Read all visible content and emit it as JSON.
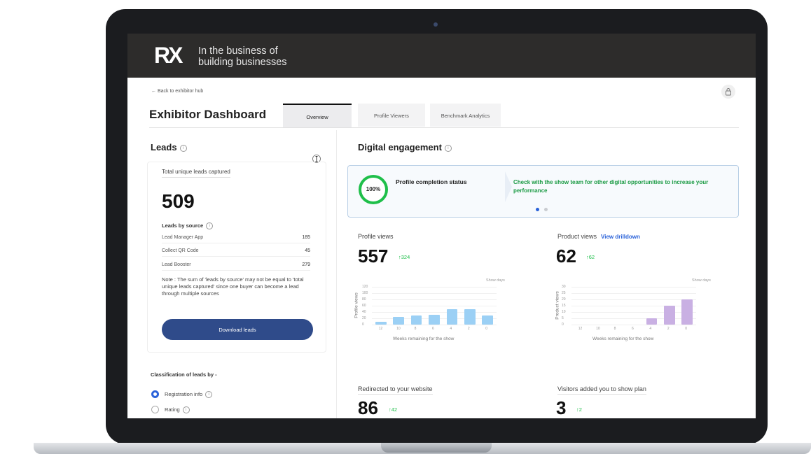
{
  "brand": {
    "logo": "RX",
    "tagline_line1": "In the business of",
    "tagline_line2": "building businesses"
  },
  "nav": {
    "back_label": "← Back to exhibitor hub",
    "page_title": "Exhibitor Dashboard",
    "tabs": [
      {
        "label": "Overview",
        "active": true
      },
      {
        "label": "Profile Viewers",
        "active": false
      },
      {
        "label": "Benchmark Analytics",
        "active": false
      }
    ]
  },
  "leads": {
    "title": "Leads",
    "total_label": "Total unique leads captured",
    "total_value": "509",
    "by_source_label": "Leads by source",
    "sources": [
      {
        "name": "Lead Manager App",
        "value": "185"
      },
      {
        "name": "Collect QR Code",
        "value": "45"
      },
      {
        "name": "Lead Booster",
        "value": "279"
      }
    ],
    "note": "Note : The sum of 'leads by source' may not be equal to 'total unique leads captured' since one buyer can become a lead through multiple sources",
    "download_label": "Download leads",
    "classification_label": "Classification of leads by -",
    "options": [
      {
        "label": "Registration info",
        "selected": true
      },
      {
        "label": "Rating",
        "selected": false
      }
    ]
  },
  "engagement": {
    "title": "Digital engagement",
    "completion_percent": "100%",
    "completion_label": "Profile completion status",
    "completion_message": "Check with the show team for other digital opportunities to increase your performance",
    "profile_views": {
      "label": "Profile views",
      "value": "557",
      "delta": "↑324"
    },
    "product_views": {
      "label": "Product views",
      "link": "View drilldown",
      "value": "62",
      "delta": "↑62"
    },
    "redirected": {
      "label": "Redirected to your website",
      "value": "86",
      "delta": "↑42"
    },
    "visitors_plan": {
      "label": "Visitors added you to show plan",
      "value": "3",
      "delta": "↑2"
    },
    "show_days_label": "Show days"
  },
  "chart_data": [
    {
      "type": "bar",
      "title": "",
      "xlabel": "Weeks remaining for the show",
      "ylabel": "Profile views",
      "categories": [
        "12",
        "10",
        "8",
        "6",
        "4",
        "2",
        "0"
      ],
      "values": [
        10,
        24,
        30,
        32,
        48,
        50,
        28
      ],
      "ylim": [
        0,
        120
      ],
      "y_ticks": [
        "120",
        "100",
        "80",
        "60",
        "40",
        "20",
        "0"
      ],
      "color": "#9bd0f5",
      "grid": true
    },
    {
      "type": "bar",
      "title": "",
      "xlabel": "Weeks remaining for the show",
      "ylabel": "Product views",
      "categories": [
        "12",
        "10",
        "8",
        "6",
        "4",
        "2",
        "0"
      ],
      "values": [
        0,
        0,
        0,
        0,
        5,
        15,
        20
      ],
      "ylim": [
        0,
        30
      ],
      "y_ticks": [
        "30",
        "25",
        "20",
        "15",
        "10",
        "5",
        "0"
      ],
      "color": "#c9b0e3",
      "grid": true
    }
  ]
}
